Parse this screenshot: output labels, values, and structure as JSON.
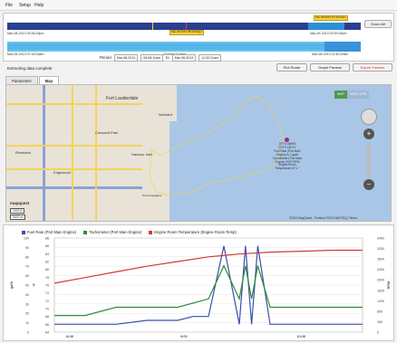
{
  "menu": [
    "File",
    "Setup",
    "Help"
  ],
  "timeline": {
    "zoom_all_label": "Zoom All",
    "start_label": "Mar-08-2013 05:46:20pm",
    "end_label": "Mar-09-2013 02:00:20pm",
    "range_start": "Mar-08-2013 07:40:04am",
    "range_end": "Mar-08-2013 11:30:20am",
    "zoomed_label": "Zoomed Dotted",
    "flag_top": "Mar-08-2013 07:40:04am",
    "flag_mid": "Mar-08-2013 08:30:00am"
  },
  "period": {
    "label": "Period",
    "start_date": "Mar-08-2013",
    "start_time": "08:08:11am",
    "to_label": "to",
    "end_date": "Mar-08-2013",
    "end_time": "11:02:21am"
  },
  "status": "Extracting data complete",
  "buttons": {
    "plot_route": "Plot Route",
    "graph_params": "Graph Params",
    "export_params": "Export Params"
  },
  "tabs": [
    "Parameters",
    "Map"
  ],
  "map": {
    "type_map": "MAP",
    "type_satellite": "SATELLITE",
    "places": [
      "Fort Lauderdale",
      "Isleward",
      "Crescent Park",
      "Harbour Inlet",
      "Riverland",
      "Edgewood",
      "Port Everglades"
    ],
    "scale": [
      "1000 ft",
      "5000 m"
    ],
    "logo": "mapquest",
    "info": "DFTS 5WHS\nDFTS 13DTY\nFuel Rate (Port Main Engine) is 1 gal/h\nTachometer (Port Main Engine) 2037 RPM\nEngine Room Temperature 67.1 °",
    "copyright": "©2013 MapQuest - Portions ©2013 NAVTEQ | Terms"
  },
  "chart_data": {
    "type": "line",
    "series": [
      {
        "name": "Fuel Rate (Port Main Engine)",
        "color": "#3a4fa8",
        "axis": "left-inner",
        "x": [
          0,
          0.05,
          0.1,
          0.2,
          0.3,
          0.4,
          0.45,
          0.5,
          0.55,
          0.6,
          0.62,
          0.64,
          0.66,
          0.7,
          0.8,
          0.9,
          1.0
        ],
        "values": [
          66,
          66,
          66,
          66,
          67,
          67,
          68,
          68,
          86,
          66,
          86,
          66,
          86,
          66,
          66,
          66,
          66
        ]
      },
      {
        "name": "Tachometer (Port Main Engine)",
        "color": "#2e8b3a",
        "axis": "right-inner",
        "x": [
          0,
          0.1,
          0.2,
          0.3,
          0.4,
          0.5,
          0.55,
          0.6,
          0.62,
          0.64,
          0.66,
          0.7,
          0.8,
          0.9,
          1.0
        ],
        "values": [
          600,
          600,
          900,
          900,
          900,
          1200,
          2400,
          1200,
          2400,
          1200,
          2400,
          900,
          900,
          900,
          900
        ]
      },
      {
        "name": "Engine Room Temperature (Engine Room Temp)",
        "color": "#d23a3a",
        "axis": "left-outer",
        "x": [
          0,
          0.1,
          0.2,
          0.3,
          0.4,
          0.5,
          0.6,
          0.7,
          0.8,
          0.9,
          1.0
        ],
        "values": [
          52,
          58,
          64,
          70,
          75,
          80,
          83,
          85,
          86,
          87,
          87
        ]
      }
    ],
    "y_left_outer": {
      "label": "gal/h",
      "ticks": [
        "100",
        "90",
        "80",
        "70",
        "60",
        "50",
        "40",
        "30",
        "20",
        "10",
        "0"
      ]
    },
    "y_left_inner": {
      "label": "°F",
      "ticks": [
        "88",
        "86",
        "84",
        "82",
        "80",
        "78",
        "76",
        "74",
        "72",
        "70",
        "68",
        "66",
        "64"
      ]
    },
    "y_right": {
      "label": "RPM",
      "ticks": [
        "3400",
        "3200",
        "2800",
        "2400",
        "2000",
        "1600",
        "1200",
        "800",
        "400",
        "0"
      ]
    },
    "x_ticks": [
      "8:08",
      "9:09",
      "10:08"
    ],
    "grid": true,
    "legend": "top"
  }
}
